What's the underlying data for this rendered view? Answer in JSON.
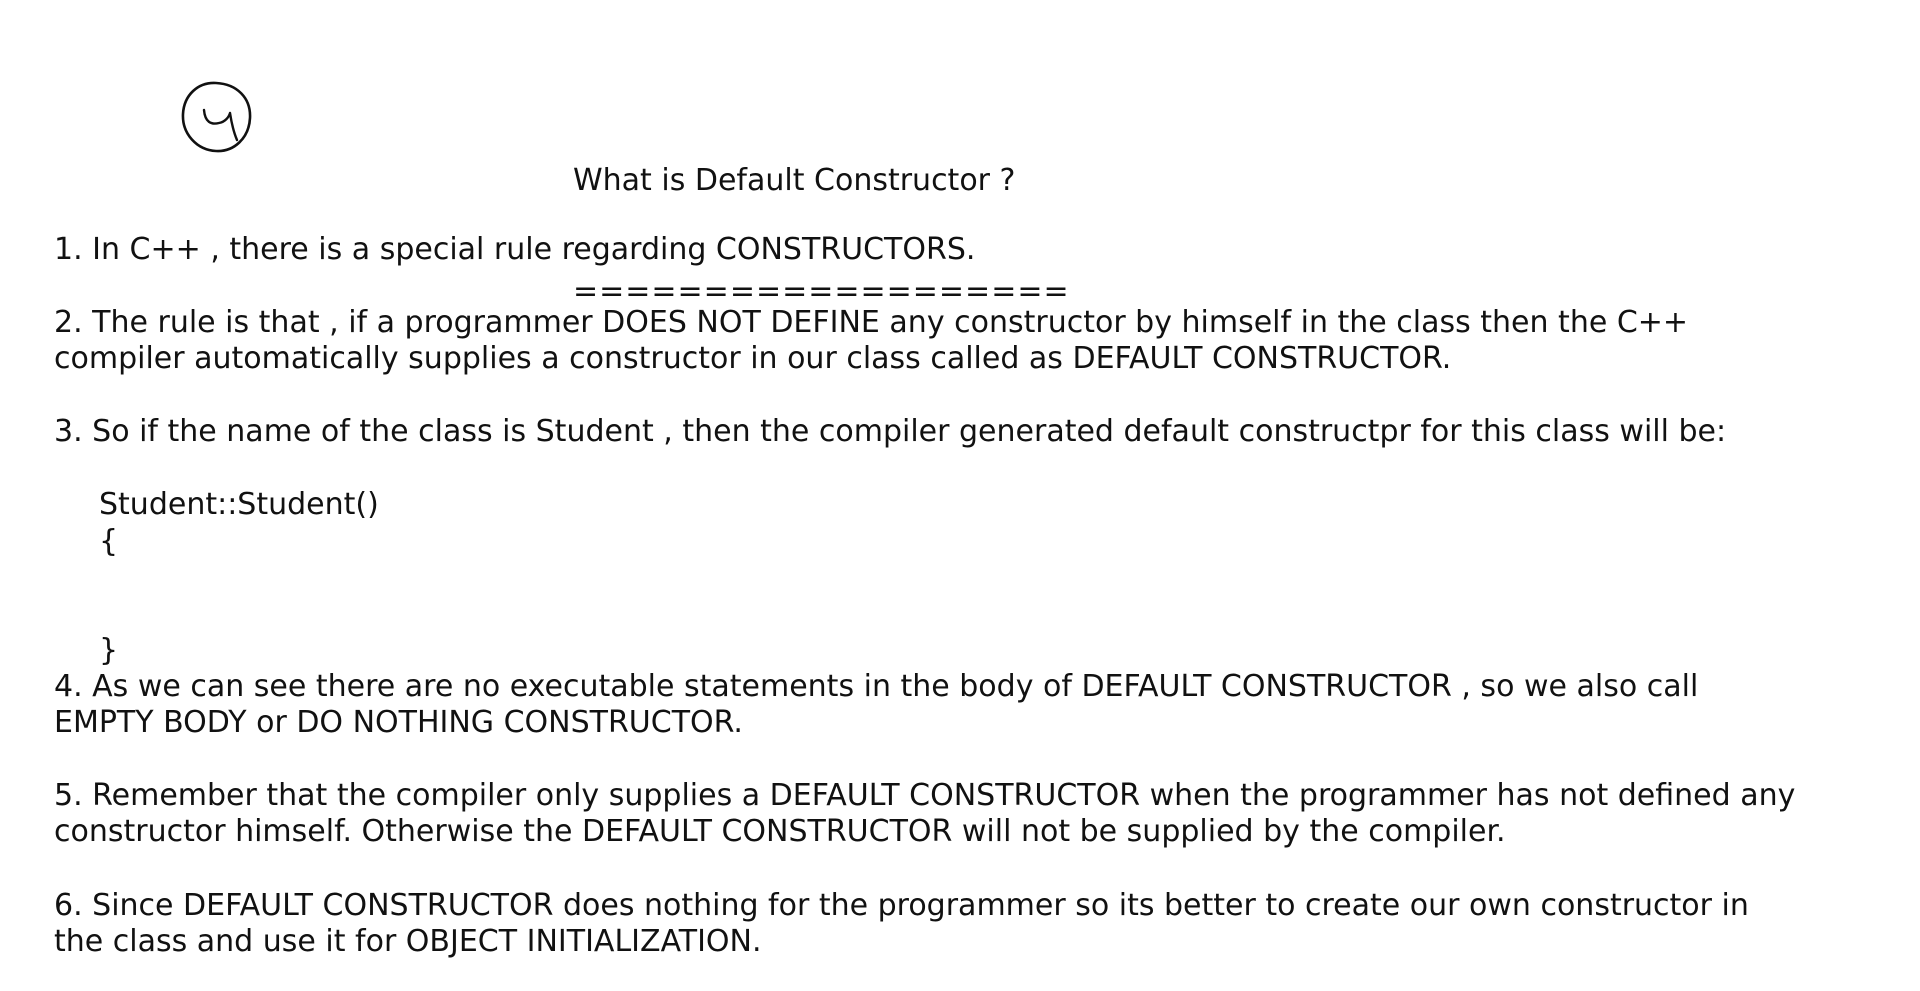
{
  "handwritten_mark": "4",
  "title": "What is Default Constructor ?",
  "title_underline": "===================",
  "points": [
    {
      "number": "1.",
      "lines": [
        "1. In C++ , there is a special rule regarding CONSTRUCTORS."
      ]
    },
    {
      "number": "2.",
      "lines": [
        "2. The rule is that , if a programmer DOES NOT DEFINE any constructor by himself in the class then the C++",
        "compiler automatically supplies a constructor in our class called as DEFAULT CONSTRUCTOR."
      ]
    },
    {
      "number": "3.",
      "lines": [
        "3. So if the name of the class is Student , then the compiler generated default constructpr for this class will be:"
      ]
    },
    {
      "number": "4.",
      "lines": [
        "4. As we can see there are no executable statements in the body of DEFAULT CONSTRUCTOR , so we also call",
        "EMPTY BODY or DO NOTHING CONSTRUCTOR."
      ]
    },
    {
      "number": "5.",
      "lines": [
        "5. Remember that the compiler only supplies a DEFAULT CONSTRUCTOR when the programmer has not defined any",
        "constructor himself. Otherwise the DEFAULT CONSTRUCTOR will not be supplied by the compiler."
      ]
    },
    {
      "number": "6.",
      "lines": [
        "6. Since DEFAULT CONSTRUCTOR does nothing for the programmer so its better to create our own constructor in",
        "the class and use it for OBJECT INITIALIZATION."
      ]
    }
  ],
  "code_example": {
    "signature": "Student::Student()",
    "open_brace": "{",
    "close_brace": "}"
  }
}
